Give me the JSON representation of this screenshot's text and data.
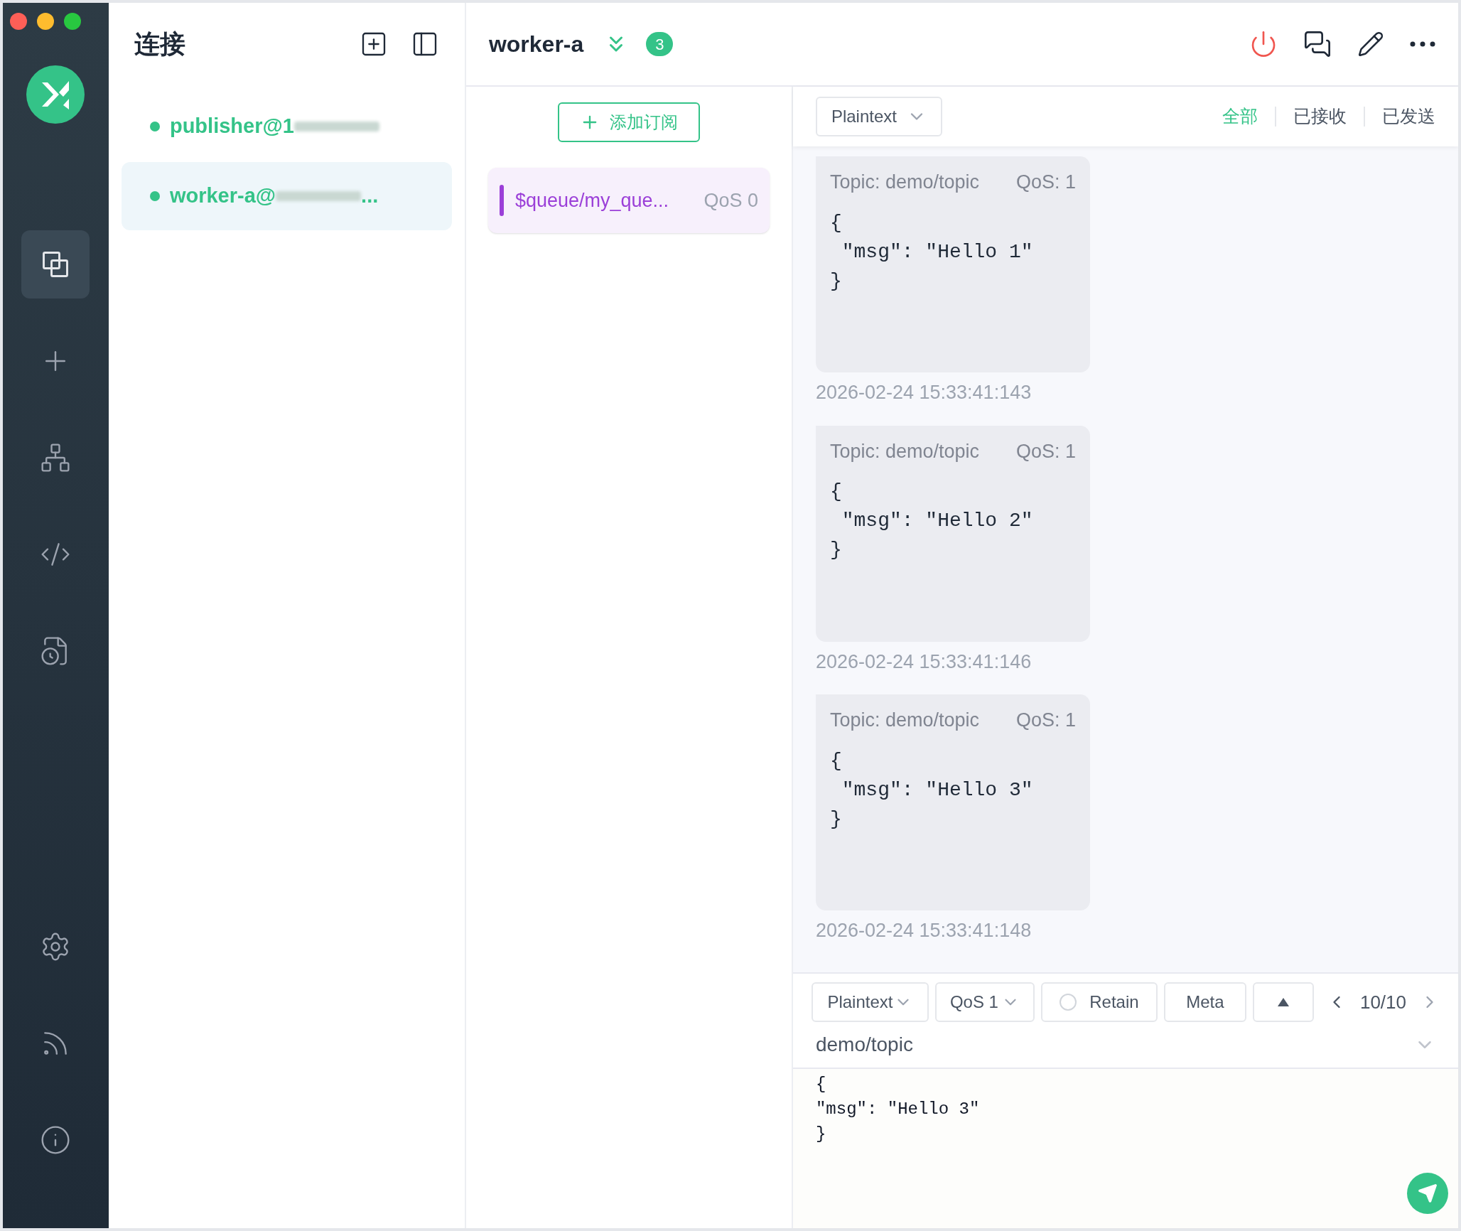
{
  "sidebar": {
    "nav": [
      {
        "kind": "connections",
        "selected": true
      },
      {
        "kind": "new",
        "selected": false
      },
      {
        "kind": "topology",
        "selected": false
      },
      {
        "kind": "script",
        "selected": false
      },
      {
        "kind": "log",
        "selected": false
      }
    ],
    "bottom": [
      {
        "kind": "settings"
      },
      {
        "kind": "feed"
      },
      {
        "kind": "about"
      }
    ]
  },
  "connections_panel": {
    "title": "连接",
    "connections": [
      {
        "name": "publisher@1",
        "connected": true,
        "selected": false
      },
      {
        "name": "worker-a@",
        "suffix": "...",
        "connected": true,
        "selected": true
      }
    ]
  },
  "header": {
    "title": "worker-a",
    "badge": "3"
  },
  "subscriptions": {
    "add_button": "添加订阅",
    "items": [
      {
        "topic": "$queue/my_que...",
        "qos": "QoS 0",
        "color": "#9b3fd8"
      }
    ]
  },
  "filter": {
    "format": "Plaintext",
    "tabs": [
      {
        "label": "全部",
        "selected": true
      },
      {
        "label": "已接收",
        "selected": false
      },
      {
        "label": "已发送",
        "selected": false
      }
    ]
  },
  "messages": [
    {
      "topic": "Topic: demo/topic",
      "qos": "QoS: 1",
      "payload": "{\n \"msg\": \"Hello 1\"\n}",
      "time": "2026-02-24 15:33:41:143"
    },
    {
      "topic": "Topic: demo/topic",
      "qos": "QoS: 1",
      "payload": "{\n \"msg\": \"Hello 2\"\n}",
      "time": "2026-02-24 15:33:41:146"
    },
    {
      "topic": "Topic: demo/topic",
      "qos": "QoS: 1",
      "payload": "{\n \"msg\": \"Hello 3\"\n}",
      "time": "2026-02-24 15:33:41:148"
    }
  ],
  "composer": {
    "format": "Plaintext",
    "qos": "QoS 1",
    "retain": {
      "label": "Retain",
      "checked": false
    },
    "meta": "Meta",
    "page": "10/10",
    "topic": "demo/topic",
    "payload": "{\n\"msg\": \"Hello 3\"\n}"
  }
}
